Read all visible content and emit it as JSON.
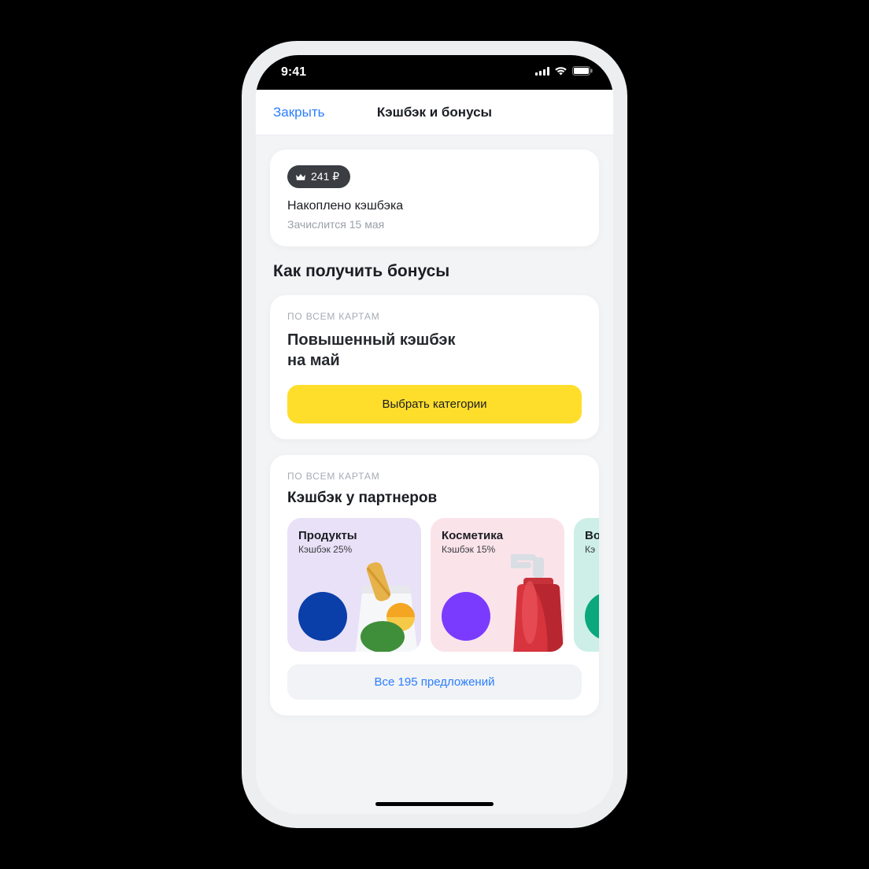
{
  "status_bar": {
    "time": "9:41"
  },
  "header": {
    "close_label": "Закрыть",
    "title": "Кэшбэк и бонусы"
  },
  "summary_card": {
    "amount": "241 ₽",
    "label": "Накоплено кэшбэка",
    "sub": "Зачислится 15 мая"
  },
  "bonuses": {
    "heading": "Как получить бонусы",
    "promo": {
      "overline": "ПО ВСЕМ КАРТАМ",
      "title_line1": "Повышенный кэшбэк",
      "title_line2": "на май",
      "button": "Выбрать категории"
    },
    "partners": {
      "overline": "ПО ВСЕМ КАРТАМ",
      "title": "Кэшбэк у партнеров",
      "tiles": [
        {
          "title": "Продукты",
          "sub": "Кэшбэк 25%"
        },
        {
          "title": "Косметика",
          "sub": "Кэшбэк 15%"
        },
        {
          "title": "Во",
          "sub": "Кэ"
        }
      ],
      "all_offers": "Все 195 предложений"
    }
  }
}
